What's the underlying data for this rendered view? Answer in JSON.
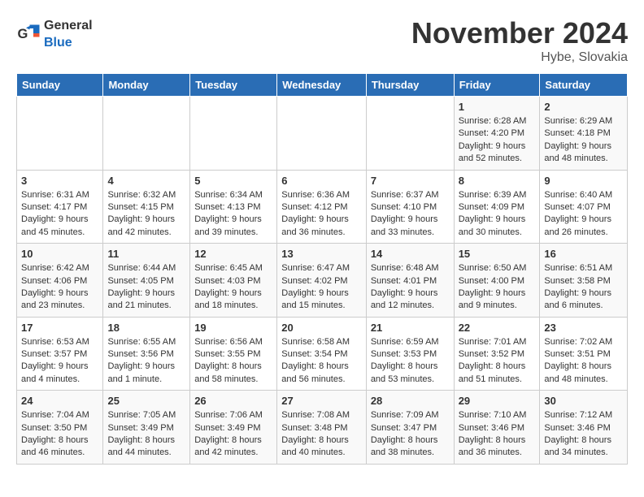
{
  "logo": {
    "general": "General",
    "blue": "Blue"
  },
  "title": "November 2024",
  "location": "Hybe, Slovakia",
  "weekdays": [
    "Sunday",
    "Monday",
    "Tuesday",
    "Wednesday",
    "Thursday",
    "Friday",
    "Saturday"
  ],
  "weeks": [
    [
      {
        "day": "",
        "sunrise": "",
        "sunset": "",
        "daylight": ""
      },
      {
        "day": "",
        "sunrise": "",
        "sunset": "",
        "daylight": ""
      },
      {
        "day": "",
        "sunrise": "",
        "sunset": "",
        "daylight": ""
      },
      {
        "day": "",
        "sunrise": "",
        "sunset": "",
        "daylight": ""
      },
      {
        "day": "",
        "sunrise": "",
        "sunset": "",
        "daylight": ""
      },
      {
        "day": "1",
        "sunrise": "Sunrise: 6:28 AM",
        "sunset": "Sunset: 4:20 PM",
        "daylight": "Daylight: 9 hours and 52 minutes."
      },
      {
        "day": "2",
        "sunrise": "Sunrise: 6:29 AM",
        "sunset": "Sunset: 4:18 PM",
        "daylight": "Daylight: 9 hours and 48 minutes."
      }
    ],
    [
      {
        "day": "3",
        "sunrise": "Sunrise: 6:31 AM",
        "sunset": "Sunset: 4:17 PM",
        "daylight": "Daylight: 9 hours and 45 minutes."
      },
      {
        "day": "4",
        "sunrise": "Sunrise: 6:32 AM",
        "sunset": "Sunset: 4:15 PM",
        "daylight": "Daylight: 9 hours and 42 minutes."
      },
      {
        "day": "5",
        "sunrise": "Sunrise: 6:34 AM",
        "sunset": "Sunset: 4:13 PM",
        "daylight": "Daylight: 9 hours and 39 minutes."
      },
      {
        "day": "6",
        "sunrise": "Sunrise: 6:36 AM",
        "sunset": "Sunset: 4:12 PM",
        "daylight": "Daylight: 9 hours and 36 minutes."
      },
      {
        "day": "7",
        "sunrise": "Sunrise: 6:37 AM",
        "sunset": "Sunset: 4:10 PM",
        "daylight": "Daylight: 9 hours and 33 minutes."
      },
      {
        "day": "8",
        "sunrise": "Sunrise: 6:39 AM",
        "sunset": "Sunset: 4:09 PM",
        "daylight": "Daylight: 9 hours and 30 minutes."
      },
      {
        "day": "9",
        "sunrise": "Sunrise: 6:40 AM",
        "sunset": "Sunset: 4:07 PM",
        "daylight": "Daylight: 9 hours and 26 minutes."
      }
    ],
    [
      {
        "day": "10",
        "sunrise": "Sunrise: 6:42 AM",
        "sunset": "Sunset: 4:06 PM",
        "daylight": "Daylight: 9 hours and 23 minutes."
      },
      {
        "day": "11",
        "sunrise": "Sunrise: 6:44 AM",
        "sunset": "Sunset: 4:05 PM",
        "daylight": "Daylight: 9 hours and 21 minutes."
      },
      {
        "day": "12",
        "sunrise": "Sunrise: 6:45 AM",
        "sunset": "Sunset: 4:03 PM",
        "daylight": "Daylight: 9 hours and 18 minutes."
      },
      {
        "day": "13",
        "sunrise": "Sunrise: 6:47 AM",
        "sunset": "Sunset: 4:02 PM",
        "daylight": "Daylight: 9 hours and 15 minutes."
      },
      {
        "day": "14",
        "sunrise": "Sunrise: 6:48 AM",
        "sunset": "Sunset: 4:01 PM",
        "daylight": "Daylight: 9 hours and 12 minutes."
      },
      {
        "day": "15",
        "sunrise": "Sunrise: 6:50 AM",
        "sunset": "Sunset: 4:00 PM",
        "daylight": "Daylight: 9 hours and 9 minutes."
      },
      {
        "day": "16",
        "sunrise": "Sunrise: 6:51 AM",
        "sunset": "Sunset: 3:58 PM",
        "daylight": "Daylight: 9 hours and 6 minutes."
      }
    ],
    [
      {
        "day": "17",
        "sunrise": "Sunrise: 6:53 AM",
        "sunset": "Sunset: 3:57 PM",
        "daylight": "Daylight: 9 hours and 4 minutes."
      },
      {
        "day": "18",
        "sunrise": "Sunrise: 6:55 AM",
        "sunset": "Sunset: 3:56 PM",
        "daylight": "Daylight: 9 hours and 1 minute."
      },
      {
        "day": "19",
        "sunrise": "Sunrise: 6:56 AM",
        "sunset": "Sunset: 3:55 PM",
        "daylight": "Daylight: 8 hours and 58 minutes."
      },
      {
        "day": "20",
        "sunrise": "Sunrise: 6:58 AM",
        "sunset": "Sunset: 3:54 PM",
        "daylight": "Daylight: 8 hours and 56 minutes."
      },
      {
        "day": "21",
        "sunrise": "Sunrise: 6:59 AM",
        "sunset": "Sunset: 3:53 PM",
        "daylight": "Daylight: 8 hours and 53 minutes."
      },
      {
        "day": "22",
        "sunrise": "Sunrise: 7:01 AM",
        "sunset": "Sunset: 3:52 PM",
        "daylight": "Daylight: 8 hours and 51 minutes."
      },
      {
        "day": "23",
        "sunrise": "Sunrise: 7:02 AM",
        "sunset": "Sunset: 3:51 PM",
        "daylight": "Daylight: 8 hours and 48 minutes."
      }
    ],
    [
      {
        "day": "24",
        "sunrise": "Sunrise: 7:04 AM",
        "sunset": "Sunset: 3:50 PM",
        "daylight": "Daylight: 8 hours and 46 minutes."
      },
      {
        "day": "25",
        "sunrise": "Sunrise: 7:05 AM",
        "sunset": "Sunset: 3:49 PM",
        "daylight": "Daylight: 8 hours and 44 minutes."
      },
      {
        "day": "26",
        "sunrise": "Sunrise: 7:06 AM",
        "sunset": "Sunset: 3:49 PM",
        "daylight": "Daylight: 8 hours and 42 minutes."
      },
      {
        "day": "27",
        "sunrise": "Sunrise: 7:08 AM",
        "sunset": "Sunset: 3:48 PM",
        "daylight": "Daylight: 8 hours and 40 minutes."
      },
      {
        "day": "28",
        "sunrise": "Sunrise: 7:09 AM",
        "sunset": "Sunset: 3:47 PM",
        "daylight": "Daylight: 8 hours and 38 minutes."
      },
      {
        "day": "29",
        "sunrise": "Sunrise: 7:10 AM",
        "sunset": "Sunset: 3:46 PM",
        "daylight": "Daylight: 8 hours and 36 minutes."
      },
      {
        "day": "30",
        "sunrise": "Sunrise: 7:12 AM",
        "sunset": "Sunset: 3:46 PM",
        "daylight": "Daylight: 8 hours and 34 minutes."
      }
    ]
  ]
}
